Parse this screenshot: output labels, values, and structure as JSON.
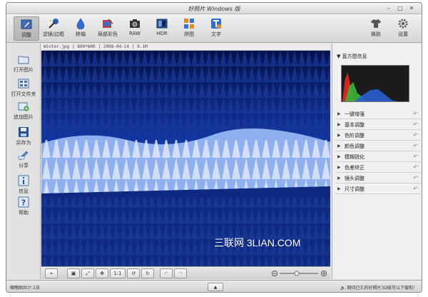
{
  "window": {
    "title": "好照片 Windows 版"
  },
  "toolbar": {
    "tools": [
      {
        "label": "调整"
      },
      {
        "label": "滤镜/边框"
      },
      {
        "label": "移轴"
      },
      {
        "label": "局部彩色"
      },
      {
        "label": "RAW"
      },
      {
        "label": "HDR"
      },
      {
        "label": "拼图"
      },
      {
        "label": "文字"
      }
    ],
    "skin_label": "换肤",
    "settings_label": "设置"
  },
  "sidebar": {
    "items": [
      {
        "label": "打开图片"
      },
      {
        "label": "打开文件夹"
      },
      {
        "label": "追加图片"
      },
      {
        "label": "另存为"
      },
      {
        "label": "分享"
      },
      {
        "label": "信息"
      },
      {
        "label": "帮助"
      }
    ]
  },
  "imageinfo": {
    "filename": "Winter.jpg",
    "dimensions": "800*600",
    "date": "2008-04-14",
    "size": "0.1M"
  },
  "bottom": {
    "ratio_label": "1:1"
  },
  "panel": {
    "histogram_title": "直方图信息",
    "adjustments": [
      {
        "label": "一键增强"
      },
      {
        "label": "基本调整"
      },
      {
        "label": "色阶调整"
      },
      {
        "label": "颜色调整"
      },
      {
        "label": "模糊锐化"
      },
      {
        "label": "色差矫正"
      },
      {
        "label": "镜头调整"
      },
      {
        "label": "尺寸调整"
      }
    ]
  },
  "status": {
    "thumbnail_count": "缩略图共计:1张",
    "message": "期待已久的好照片3D版可以下载啦！"
  },
  "watermark": {
    "text": "三联网 3LIAN.COM"
  },
  "colors": {
    "photo_sky": "#0a1a5c",
    "accent": "#2a6fd0"
  }
}
